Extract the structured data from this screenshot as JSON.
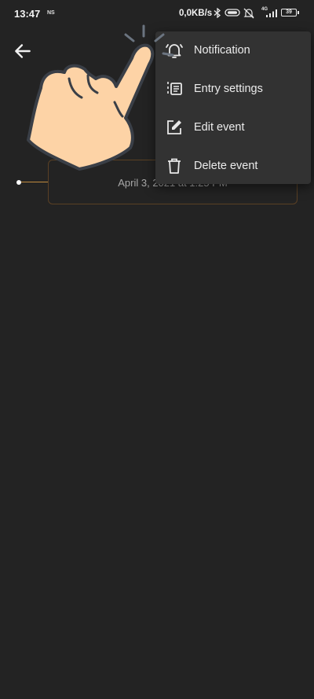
{
  "status_bar": {
    "time": "13:47",
    "carrier_tag": "NS",
    "net_speed": "0,0KB/s",
    "signal_tag": "4G",
    "battery": "39"
  },
  "event": {
    "date_label": "April 3, 2021 at 1:25 PM"
  },
  "menu": {
    "items": [
      {
        "label": "Notification",
        "icon": "bell-icon"
      },
      {
        "label": "Entry settings",
        "icon": "list-settings-icon"
      },
      {
        "label": "Edit event",
        "icon": "edit-icon"
      },
      {
        "label": "Delete event",
        "icon": "trash-icon"
      }
    ]
  },
  "colors": {
    "background": "#232323",
    "menu_background": "#323232",
    "accent": "#c08a3e",
    "hand_fill": "#fdd3a6"
  }
}
